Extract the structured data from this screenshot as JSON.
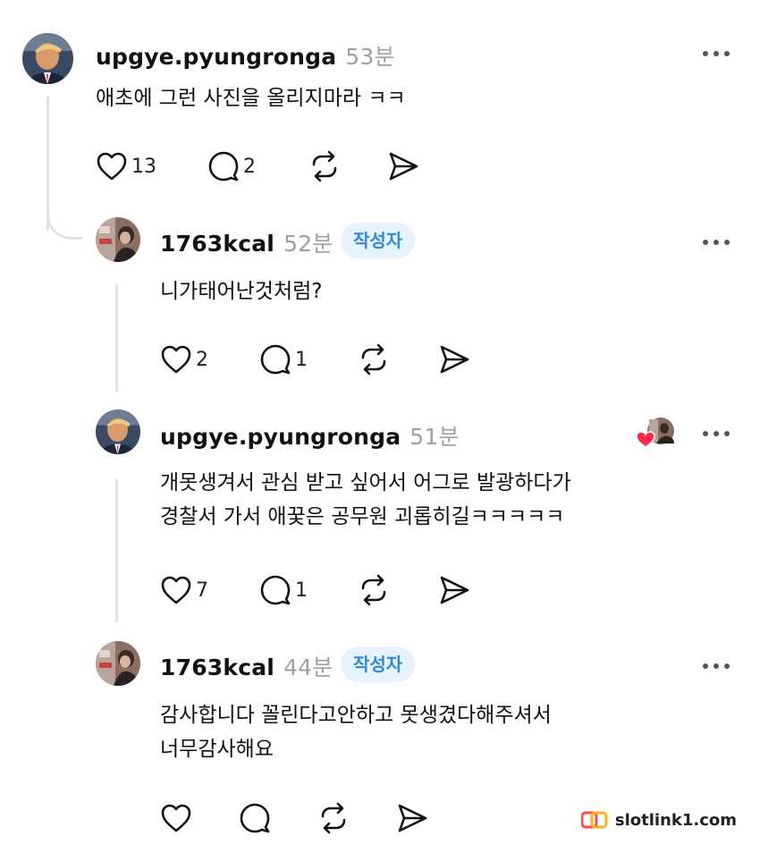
{
  "comments": [
    {
      "username": "upgye.pyungronga",
      "time": "53분",
      "text": "애초에 그런 사진을 올리지마라 ㅋㅋ",
      "likes": "13",
      "replies": "2",
      "avatar_icon": "trump-avatar"
    },
    {
      "username": "1763kcal",
      "time": "52분",
      "badge": "작성자",
      "text": "니가태어난것처럼?",
      "likes": "2",
      "replies": "1",
      "avatar_icon": "photo-avatar"
    },
    {
      "username": "upgye.pyungronga",
      "time": "51분",
      "text": "개못생겨서 관심 받고 싶어서 어그로 발광하다가\n경찰서 가서 애꿎은 공무원 괴롭히길ㅋㅋㅋㅋㅋ",
      "likes": "7",
      "replies": "1",
      "avatar_icon": "trump-avatar",
      "reaction_icon": "author-liked-heart-icon"
    },
    {
      "username": "1763kcal",
      "time": "44분",
      "badge": "작성자",
      "text": "감사합니다 꼴린다고안하고 못생겼다해주셔서\n너무감사해요",
      "likes": "",
      "replies": "",
      "avatar_icon": "photo-avatar"
    }
  ],
  "icons": {
    "like": "heart-icon",
    "reply": "comment-icon",
    "repost": "repost-icon",
    "share": "send-icon",
    "more": "more-dots-icon"
  },
  "watermark": {
    "text": "slotlink1.com"
  },
  "colors": {
    "badge_bg": "#e6f2fd",
    "badge_text": "#2f8ad8",
    "time_gray": "#a0a0a0",
    "thread_line": "#e2e2e2",
    "reaction_heart": "#ff2b4a"
  }
}
